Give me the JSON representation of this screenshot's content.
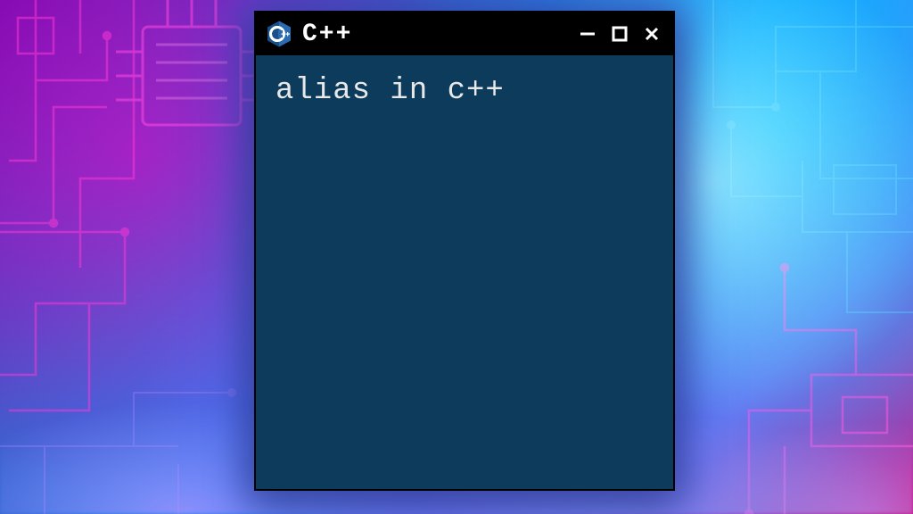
{
  "window": {
    "title": "C++",
    "icon_name": "cpp-logo-icon",
    "content_text": "alias in c++",
    "titlebar_bg": "#000000",
    "body_bg": "#0d3b5c",
    "text_color": "#e8e8e8"
  },
  "controls": {
    "minimize_glyph": "—",
    "maximize_glyph": "☐",
    "close_glyph": "✕"
  }
}
